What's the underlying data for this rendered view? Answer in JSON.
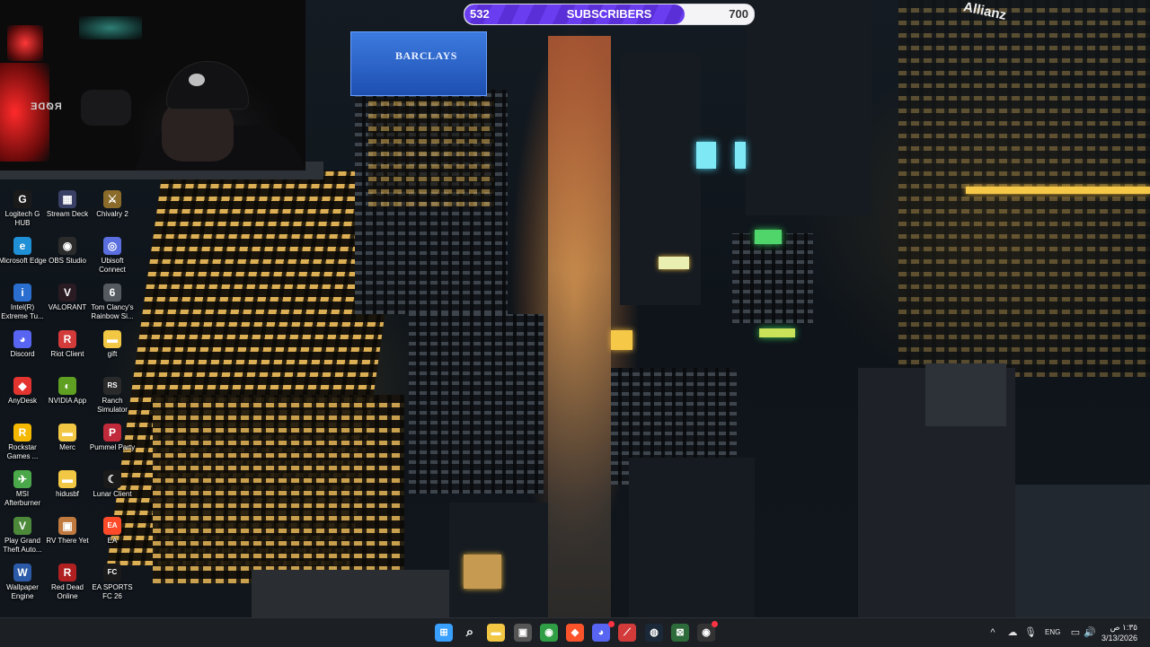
{
  "overlay": {
    "subscribers": {
      "current": "532",
      "label": "SUBSCRIBERS",
      "target": "700",
      "progress": 0.76
    }
  },
  "wallpaper": {
    "signs": {
      "barclays": "BARCLAYS",
      "allianz": "Allianz"
    }
  },
  "webcam": {
    "mic_brand": "RØDE"
  },
  "desktop_icons": [
    {
      "label": "Logitech G HUB",
      "icon": "logitech-icon",
      "color": "#1a1a1a",
      "glyph": "G"
    },
    {
      "label": "Stream Deck",
      "icon": "stream-deck-icon",
      "color": "#3a3f66",
      "glyph": "▦"
    },
    {
      "label": "Chivalry 2",
      "icon": "chivalry-icon",
      "color": "#8a6b2a",
      "glyph": "⚔"
    },
    {
      "label": "Microsoft Edge",
      "icon": "edge-icon",
      "color": "#1f8fd6",
      "glyph": "e"
    },
    {
      "label": "OBS Studio",
      "icon": "obs-icon",
      "color": "#2b2b2b",
      "glyph": "◉"
    },
    {
      "label": "Ubisoft Connect",
      "icon": "ubisoft-icon",
      "color": "#5a6ee0",
      "glyph": "◎"
    },
    {
      "label": "Intel(R) Extreme Tu...",
      "icon": "intel-icon",
      "color": "#2a6fd0",
      "glyph": "i"
    },
    {
      "label": "VALORANT",
      "icon": "valorant-icon",
      "color": "#2a1a22",
      "glyph": "V"
    },
    {
      "label": "Tom Clancy's Rainbow Si...",
      "icon": "rainbow-six-icon",
      "color": "#555a60",
      "glyph": "6"
    },
    {
      "label": "Discord",
      "icon": "discord-icon",
      "color": "#5865f2",
      "glyph": "◕"
    },
    {
      "label": "Riot Client",
      "icon": "riot-icon",
      "color": "#d33b3b",
      "glyph": "R"
    },
    {
      "label": "gift",
      "icon": "folder-icon",
      "color": "#f2c744",
      "glyph": "▬"
    },
    {
      "label": "AnyDesk",
      "icon": "anydesk-icon",
      "color": "#e3342f",
      "glyph": "◆"
    },
    {
      "label": "NVIDIA App",
      "icon": "nvidia-icon",
      "color": "#5fa022",
      "glyph": "◐"
    },
    {
      "label": "Ranch Simulator",
      "icon": "ranch-icon",
      "color": "#2a2a2a",
      "glyph": "RS"
    },
    {
      "label": "Rockstar Games ...",
      "icon": "rockstar-icon",
      "color": "#f5b800",
      "glyph": "R"
    },
    {
      "label": "Merc",
      "icon": "folder-icon",
      "color": "#f2c744",
      "glyph": "▬"
    },
    {
      "label": "Pummel Party",
      "icon": "pummel-party-icon",
      "color": "#c02a3a",
      "glyph": "P"
    },
    {
      "label": "MSI Afterburner",
      "icon": "msi-afterburner-icon",
      "color": "#4aa84a",
      "glyph": "✈"
    },
    {
      "label": "hidusbf",
      "icon": "folder-icon",
      "color": "#f2c744",
      "glyph": "▬"
    },
    {
      "label": "Lunar Client",
      "icon": "lunar-client-icon",
      "color": "#1a1a1a",
      "glyph": "☾"
    },
    {
      "label": "Play Grand Theft Auto...",
      "icon": "gta-icon",
      "color": "#4c8a3a",
      "glyph": "V"
    },
    {
      "label": "RV There Yet",
      "icon": "rv-there-yet-icon",
      "color": "#c07a40",
      "glyph": "▣"
    },
    {
      "label": "EA",
      "icon": "ea-icon",
      "color": "#ff4a2a",
      "glyph": "EA"
    },
    {
      "label": "Wallpaper Engine",
      "icon": "wallpaper-engine-icon",
      "color": "#2a5aa8",
      "glyph": "W"
    },
    {
      "label": "Red Dead Online",
      "icon": "red-dead-icon",
      "color": "#b02020",
      "glyph": "R"
    },
    {
      "label": "EA SPORTS FC 26",
      "icon": "ea-sports-fc-icon",
      "color": "#1a1a1a",
      "glyph": "FC"
    }
  ],
  "taskbar": {
    "pinned": [
      {
        "icon": "windows-start-icon",
        "glyph": "⊞",
        "color": "#3aa0ff"
      },
      {
        "icon": "search-icon",
        "glyph": "⌕",
        "color": "transparent"
      },
      {
        "icon": "file-explorer-icon",
        "glyph": "▬",
        "color": "#f2c744"
      },
      {
        "icon": "microsoft-store-icon",
        "glyph": "▣",
        "color": "#555"
      },
      {
        "icon": "chrome-icon",
        "glyph": "◉",
        "color": "#2f9e44"
      },
      {
        "icon": "brave-icon",
        "glyph": "◆",
        "color": "#fb542b"
      },
      {
        "icon": "discord-icon",
        "glyph": "◕",
        "color": "#5865f2"
      },
      {
        "icon": "red-app-icon",
        "glyph": "⟋",
        "color": "#d33b3b"
      },
      {
        "icon": "steam-icon",
        "glyph": "◍",
        "color": "#1b2838"
      },
      {
        "icon": "xbox-icon",
        "glyph": "⊠",
        "color": "#2e6b3a"
      },
      {
        "icon": "obs-icon",
        "glyph": "◉",
        "color": "#333"
      }
    ],
    "discord_badge": "1",
    "tray": {
      "chevron": "^",
      "language": "ENG",
      "time": "١:٣٥ ص",
      "date": "3/13/2026"
    }
  }
}
